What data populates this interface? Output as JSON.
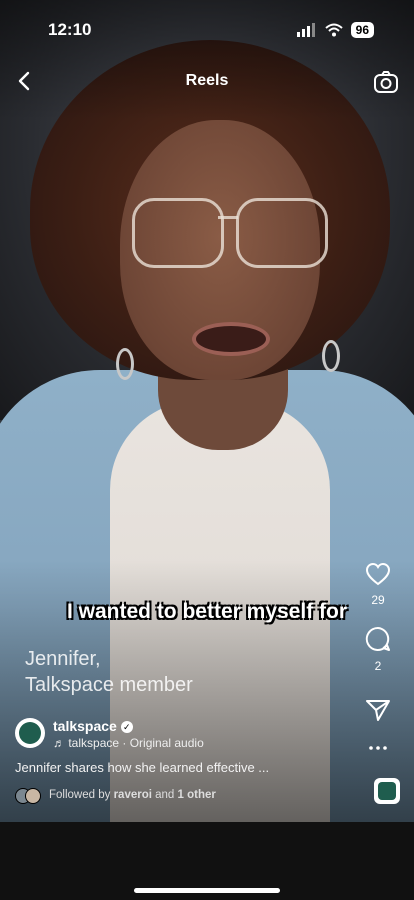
{
  "status_bar": {
    "time": "12:10",
    "battery": "96"
  },
  "header": {
    "title": "Reels"
  },
  "video": {
    "caption": "I wanted to better myself for",
    "name_line1": "Jennifer,",
    "name_line2": "Talkspace member"
  },
  "actions": {
    "likes": "29",
    "comments": "2"
  },
  "post": {
    "handle": "talkspace",
    "audio": "talkspace · Original audio",
    "description": "Jennifer shares how she learned effective ...",
    "followed_prefix": "Followed by ",
    "followed_user": "raveroi",
    "followed_mid": " and ",
    "followed_other": "1 other"
  },
  "icons": {
    "back": "chevron-left-icon",
    "camera": "camera-icon",
    "like": "heart-icon",
    "comment": "comment-icon",
    "share": "send-icon",
    "more": "more-dots-icon"
  }
}
